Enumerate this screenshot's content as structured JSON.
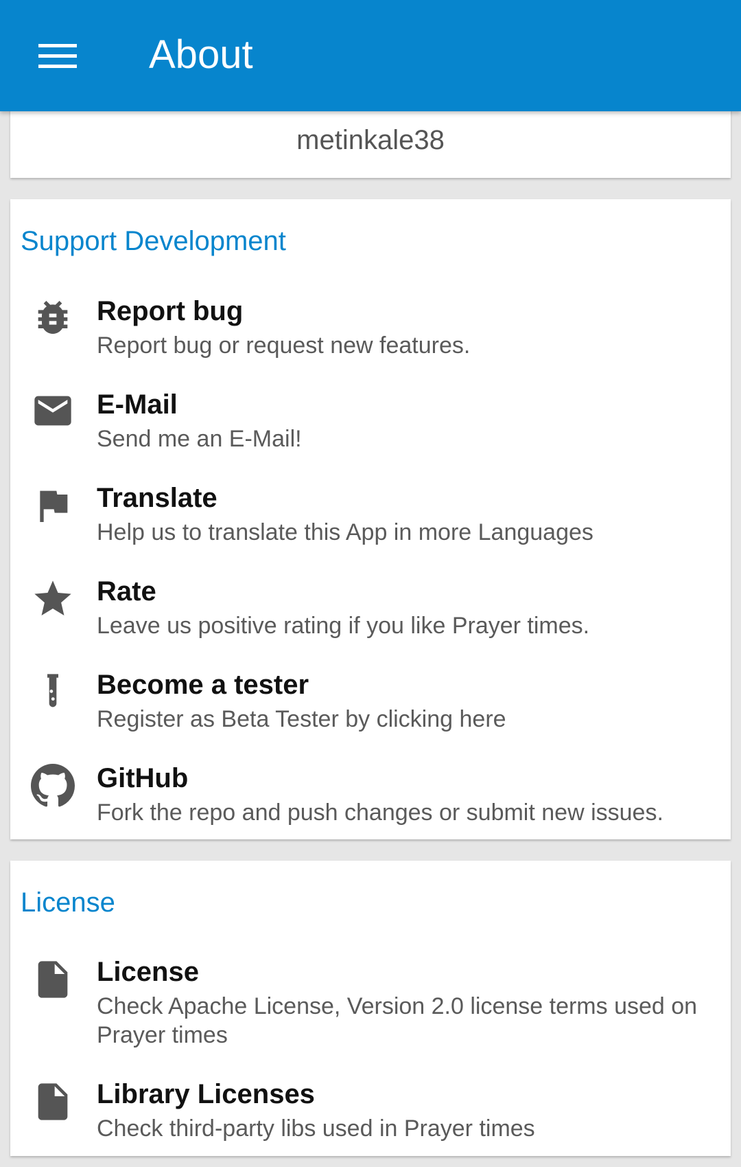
{
  "appbar": {
    "title": "About",
    "menu_icon": "hamburger-menu-icon"
  },
  "author_card": {
    "name": "metinkale38"
  },
  "support": {
    "heading": "Support Development",
    "items": [
      {
        "icon": "bug-icon",
        "title": "Report bug",
        "subtitle": "Report bug or request new features."
      },
      {
        "icon": "email-icon",
        "title": "E-Mail",
        "subtitle": "Send me an E-Mail!"
      },
      {
        "icon": "flag-icon",
        "title": "Translate",
        "subtitle": "Help us to translate this App in more Languages"
      },
      {
        "icon": "star-icon",
        "title": "Rate",
        "subtitle": "Leave us positive rating if you like Prayer times."
      },
      {
        "icon": "test-tube-icon",
        "title": "Become a tester",
        "subtitle": "Register as Beta Tester by clicking here"
      },
      {
        "icon": "github-icon",
        "title": "GitHub",
        "subtitle": "Fork the repo and push changes or submit new issues."
      }
    ]
  },
  "license": {
    "heading": "License",
    "items": [
      {
        "icon": "file-icon",
        "title": "License",
        "subtitle": "Check Apache License, Version 2.0 license terms used on Prayer times"
      },
      {
        "icon": "file-icon",
        "title": "Library Licenses",
        "subtitle": "Check third-party libs used in Prayer times"
      }
    ]
  },
  "colors": {
    "primary": "#0785cd",
    "icon": "#555555",
    "background": "#e6e6e6"
  }
}
